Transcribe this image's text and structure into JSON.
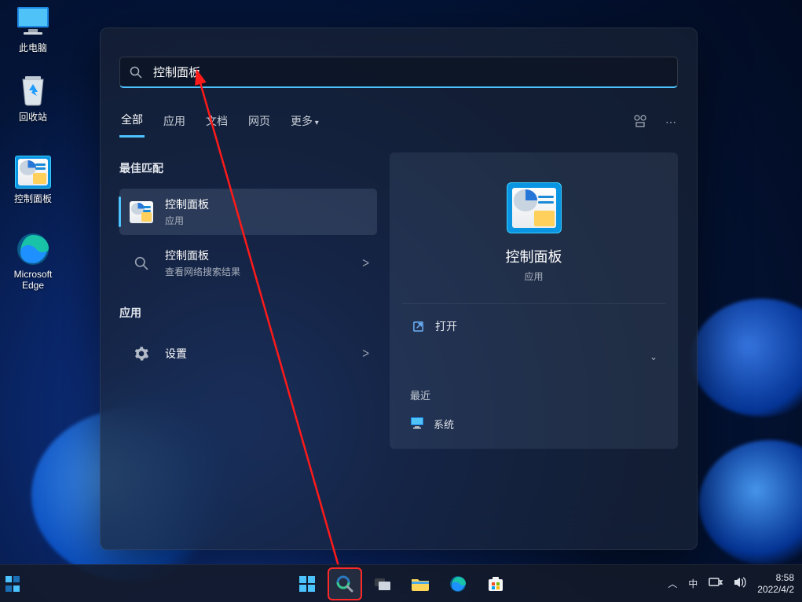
{
  "desktop": {
    "this_pc": "此电脑",
    "recycle": "回收站",
    "control_panel": "控制面板",
    "edge": "Microsoft\nEdge"
  },
  "search": {
    "query": "控制面板",
    "tabs": {
      "all": "全部",
      "apps": "应用",
      "docs": "文档",
      "web": "网页",
      "more": "更多"
    },
    "sections": {
      "best_match": "最佳匹配",
      "apps": "应用"
    },
    "best": {
      "title": "控制面板",
      "subtitle": "应用"
    },
    "web": {
      "title": "控制面板",
      "subtitle": "查看网络搜索结果"
    },
    "apps_list": [
      {
        "title": "设置"
      }
    ]
  },
  "preview": {
    "title": "控制面板",
    "subtitle": "应用",
    "open": "打开",
    "recent_header": "最近",
    "recent_item": "系统"
  },
  "taskbar": {
    "ime": "中",
    "time": "8:58",
    "date": "2022/4/2"
  }
}
